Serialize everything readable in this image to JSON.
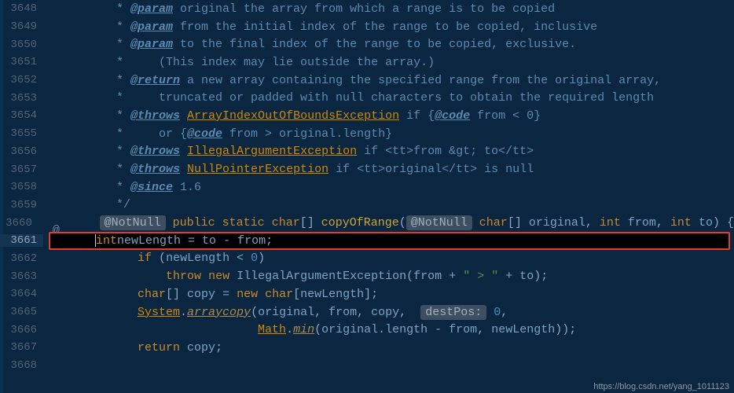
{
  "lines": {
    "3648": {
      "n": "3648"
    },
    "3649": {
      "n": "3649"
    },
    "3650": {
      "n": "3650"
    },
    "3651": {
      "n": "3651"
    },
    "3652": {
      "n": "3652"
    },
    "3653": {
      "n": "3653"
    },
    "3654": {
      "n": "3654"
    },
    "3655": {
      "n": "3655"
    },
    "3656": {
      "n": "3656"
    },
    "3657": {
      "n": "3657"
    },
    "3658": {
      "n": "3658"
    },
    "3659": {
      "n": "3659"
    },
    "3660": {
      "n": "3660"
    },
    "3661": {
      "n": "3661"
    },
    "3662": {
      "n": "3662"
    },
    "3663": {
      "n": "3663"
    },
    "3664": {
      "n": "3664"
    },
    "3665": {
      "n": "3665"
    },
    "3666": {
      "n": "3666"
    },
    "3667": {
      "n": "3667"
    },
    "3668": {
      "n": "3668"
    }
  },
  "tags": {
    "param": "@param",
    "ret": "@return",
    "throws": "@throws",
    "code": "@code",
    "since": "@since"
  },
  "cmt": {
    "l3648": " original the array from which a range is to be copied",
    "l3649": " from the initial index of the range to be copied, inclusive",
    "l3650": " to the final index of the range to be copied, exclusive.",
    "l3651": "     (This index may lie outside the array.)",
    "l3652": " a new array containing the specified range from the original array,",
    "l3653": "     truncated or padded with null characters to obtain the required length",
    "l3654a": " if {",
    "l3654b": " from < 0}",
    "l3655a": "     or {",
    "l3655b": " from > original.length}",
    "l3656": " if <tt>from &gt; to</tt>",
    "l3657": " if <tt>original</tt> is null",
    "l3658": " 1.6",
    "star": "     * ",
    "starb": "     *",
    "end": "     */"
  },
  "exc": {
    "aioobe": "ArrayIndexOutOfBoundsException",
    "iae": "IllegalArgumentException",
    "npe": "NullPointerException"
  },
  "hints": {
    "nn": "@NotNull",
    "dp": "destPos:"
  },
  "code": {
    "pub": "public",
    "sta": "static",
    "ch": "char",
    "int_": "int",
    "if_": "if",
    "thr": "throw",
    "new_": "new",
    "ret": "return",
    "cor": "copyOfRange",
    "orig": "original",
    "from": "from",
    "to": "to",
    "nl": "newLength",
    "copy": "copy",
    "zero": "0",
    "sys": "System",
    "ac": "arraycopy",
    "math": "Math",
    "min": "min",
    "len": "length",
    "gt": "\" > \"",
    "plus": " + ",
    "eq": " = ",
    "minus": " - ",
    "lt": " < ",
    "dot": ".",
    "sc": ";",
    "cm": ", ",
    "lb": "[] ",
    "lb2": "[",
    "rb": "]",
    "lp": "(",
    "rp": ")",
    "ob": " {",
    "cb": "}"
  },
  "watermark": "https://blog.csdn.net/yang_1011123",
  "atIcon": "@"
}
